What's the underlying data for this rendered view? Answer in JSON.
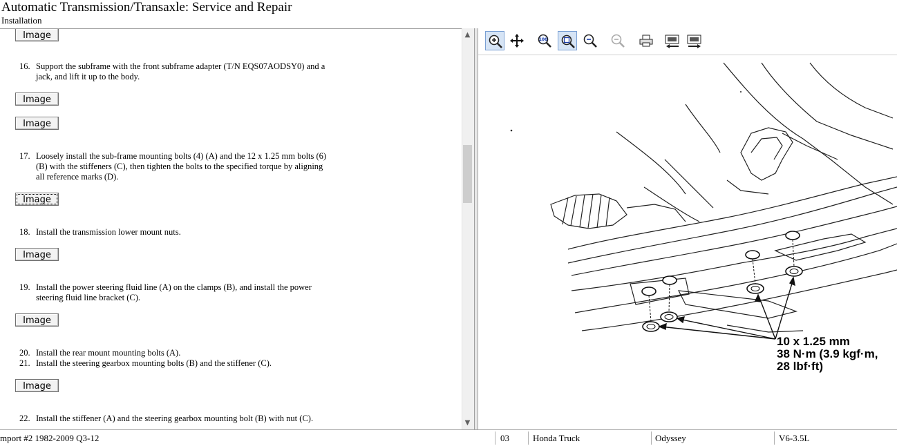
{
  "window": {
    "title": "Automatic Transmission/Transaxle:  Service and Repair",
    "subtitle": "Installation"
  },
  "steps": {
    "image_label": "Image",
    "s16": {
      "num": "16.",
      "line1": "Support the subframe with the front subframe adapter (T/N EQS07AODSY0) and a",
      "line2": "jack, and lift it up to the body."
    },
    "s17": {
      "num": "17.",
      "line1": "Loosely install the sub-frame mounting bolts (4) (A) and the 12 x 1.25 mm bolts (6)",
      "line2": "(B) with the stiffeners (C), then tighten the bolts to the specified torque by aligning",
      "line3": "all reference marks (D)."
    },
    "s18": {
      "num": "18.",
      "line1": "Install the transmission lower mount nuts."
    },
    "s19": {
      "num": "19.",
      "line1": "Install the power steering fluid line (A) on the clamps (B), and install the power",
      "line2": "steering fluid line bracket (C)."
    },
    "s20": {
      "num": "20.",
      "line1": "Install the rear mount mounting bolts (A)."
    },
    "s21": {
      "num": "21.",
      "line1": "Install the steering gearbox mounting bolts (B) and the stiffener (C)."
    },
    "s22": {
      "num": "22.",
      "line1": "Install the stiffener (A) and the steering gearbox mounting bolt (B) with nut (C)."
    }
  },
  "toolbar": {
    "buttons": [
      "zoom-in-icon",
      "pan-icon",
      "actual-size-icon",
      "fit-window-icon",
      "zoom-in-small-icon",
      "zoom-out-icon",
      "print-icon",
      "prev-image-icon",
      "next-image-icon"
    ]
  },
  "diagram": {
    "spec_line1": "10 x 1.25 mm",
    "spec_line2": "38 N·m (3.9 kgf·m,",
    "spec_line3": "28 lbf·ft)"
  },
  "status": {
    "source": "mport #2 1982-2009 Q3-12",
    "code": "03",
    "make": "Honda Truck",
    "model": "Odyssey",
    "engine": "V6-3.5L"
  }
}
